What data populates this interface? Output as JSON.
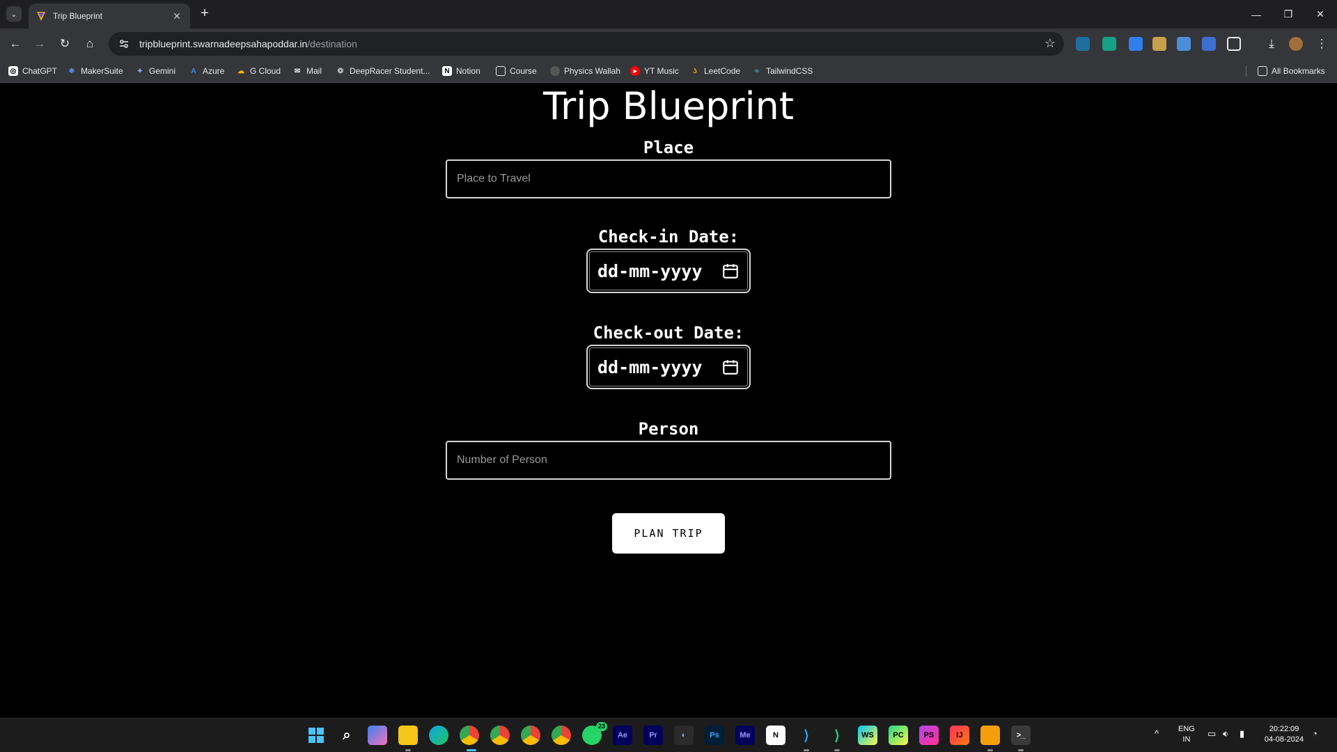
{
  "browser": {
    "tab_title": "Trip Blueprint",
    "url_host": "tripblueprint.swarnadeepsahapoddar.in",
    "url_path": "/destination",
    "bookmarks": [
      {
        "label": "ChatGPT",
        "icon": "chatgpt-icon"
      },
      {
        "label": "MakerSuite",
        "icon": "makersuite-icon"
      },
      {
        "label": "Gemini",
        "icon": "gemini-icon"
      },
      {
        "label": "Azure",
        "icon": "azure-icon"
      },
      {
        "label": "G Cloud",
        "icon": "gcloud-icon"
      },
      {
        "label": "Mail",
        "icon": "mail-icon"
      },
      {
        "label": "DeepRacer Student...",
        "icon": "deepracer-icon"
      },
      {
        "label": "Notion",
        "icon": "notion-icon"
      },
      {
        "label": "Course",
        "icon": "folder-icon"
      },
      {
        "label": "Physics Wallah",
        "icon": "physicswallah-icon"
      },
      {
        "label": "YT Music",
        "icon": "ytmusic-icon"
      },
      {
        "label": "LeetCode",
        "icon": "leetcode-icon"
      },
      {
        "label": "TailwindCSS",
        "icon": "tailwind-icon"
      }
    ],
    "all_bookmarks": "All Bookmarks"
  },
  "page": {
    "title": "Trip Blueprint",
    "place_label": "Place",
    "place_placeholder": "Place to Travel",
    "checkin_label": "Check-in Date:",
    "checkin_value": "dd-mm-yyyy",
    "checkout_label": "Check-out Date:",
    "checkout_value": "dd-mm-yyyy",
    "person_label": "Person",
    "person_placeholder": "Number of Person",
    "submit_label": "PLAN TRIP"
  },
  "taskbar": {
    "whatsapp_badge": "23",
    "lang_line1": "ENG",
    "lang_line2": "IN",
    "time": "20:22:09",
    "date": "04-08-2024"
  },
  "colors": {
    "page_bg": "#000000",
    "button_bg": "#ffffff",
    "chrome_bg": "#35363a"
  }
}
